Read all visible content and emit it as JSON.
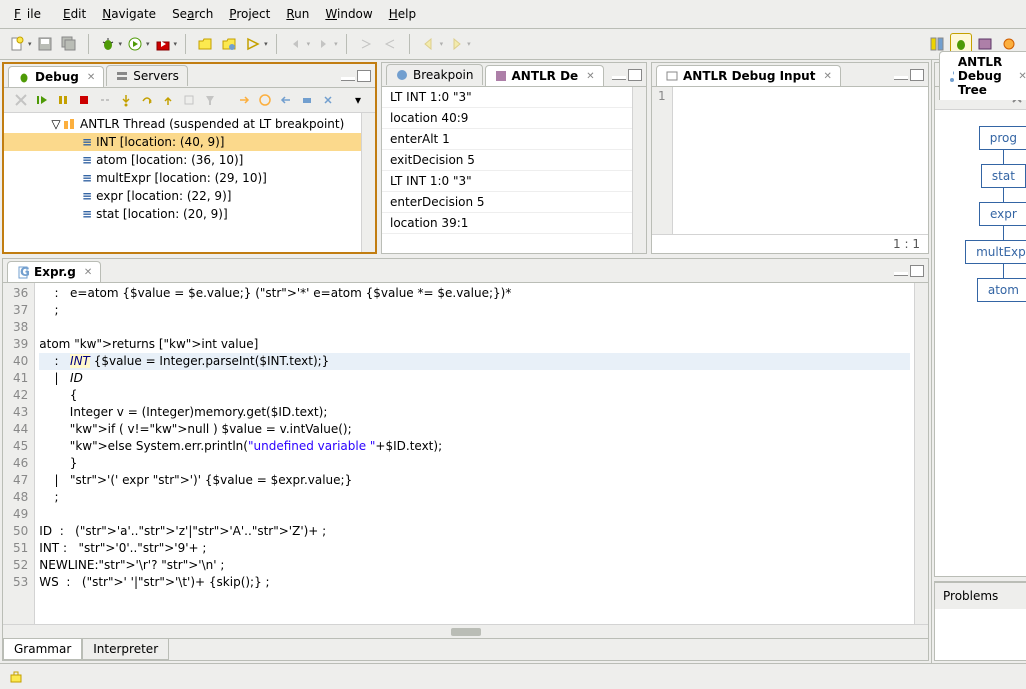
{
  "menu": {
    "file": "File",
    "edit": "Edit",
    "navigate": "Navigate",
    "search": "Search",
    "project": "Project",
    "run": "Run",
    "window": "Window",
    "help": "Help"
  },
  "toolbar_icons": [
    "new",
    "save",
    "save-all",
    "debug",
    "run",
    "ext-tools",
    "open",
    "open-type",
    "search",
    "back",
    "fwd",
    "up",
    "next",
    "prev",
    "last"
  ],
  "panels": {
    "debug": {
      "tab1": "Debug",
      "tab2": "Servers",
      "thread": "ANTLR Thread (suspended at LT breakpoint)",
      "frames": [
        "INT [location: (40, 9)]",
        "atom [location: (36, 10)]",
        "multExpr [location: (29, 10)]",
        "expr [location: (22, 9)]",
        "stat [location: (20, 9)]"
      ],
      "selected": 0
    },
    "breakpoints": {
      "title": "Breakpoin"
    },
    "antlr_debug": {
      "title": "ANTLR De",
      "events": [
        "LT INT 1:0 \"3\"",
        "location 40:9",
        "enterAlt 1",
        "exitDecision 5",
        "LT INT 1:0 \"3\"",
        "enterDecision 5",
        "location 39:1"
      ]
    },
    "debug_input": {
      "title": "ANTLR Debug Input",
      "line_no": "1",
      "cursor": "1 : 1"
    },
    "editor": {
      "title": "Expr.g",
      "lines": [
        {
          "n": 36,
          "t": "    :   e=atom {$value = $e.value;} ('*' e=atom {$value *= $e.value;})*"
        },
        {
          "n": 37,
          "t": "    ;"
        },
        {
          "n": 38,
          "t": ""
        },
        {
          "n": 39,
          "t": "atom returns [int value]"
        },
        {
          "n": 40,
          "t": "    :   INT {$value = Integer.parseInt($INT.text);}",
          "hl": true
        },
        {
          "n": 41,
          "t": "    |   ID"
        },
        {
          "n": 42,
          "t": "        {"
        },
        {
          "n": 43,
          "t": "        Integer v = (Integer)memory.get($ID.text);"
        },
        {
          "n": 44,
          "t": "        if ( v!=null ) $value = v.intValue();"
        },
        {
          "n": 45,
          "t": "        else System.err.println(\"undefined variable \"+$ID.text);"
        },
        {
          "n": 46,
          "t": "        }"
        },
        {
          "n": 47,
          "t": "    |   '(' expr ')' {$value = $expr.value;}"
        },
        {
          "n": 48,
          "t": "    ;"
        },
        {
          "n": 49,
          "t": ""
        },
        {
          "n": 50,
          "t": "ID  :   ('a'..'z'|'A'..'Z')+ ;"
        },
        {
          "n": 51,
          "t": "INT :   '0'..'9'+ ;"
        },
        {
          "n": 52,
          "t": "NEWLINE:'\\r'? '\\n' ;"
        },
        {
          "n": 53,
          "t": "WS  :   (' '|'\\t')+ {skip();} ;"
        }
      ],
      "bottom_tabs": {
        "grammar": "Grammar",
        "interpreter": "Interpreter"
      }
    },
    "debug_tree": {
      "title": "ANTLR Debug Tree",
      "nodes": [
        "prog",
        "stat",
        "expr",
        "multExpr",
        "atom"
      ]
    },
    "problems": {
      "title": "Problems"
    }
  }
}
